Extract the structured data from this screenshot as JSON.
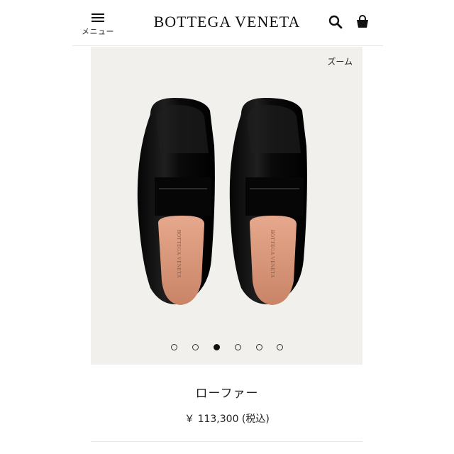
{
  "header": {
    "menu_label": "メニュー",
    "brand": "BOTTEGA VENETA",
    "icons": {
      "menu": "hamburger-icon",
      "search": "search-icon",
      "cart": "shopping-bag-icon"
    }
  },
  "gallery": {
    "zoom_label": "ズーム",
    "insole_brand": "BOTTEGA VENETA",
    "slide_count": 6,
    "active_slide": 3,
    "colors": {
      "background": "#f1f0ec",
      "leather": "#0c0c0c",
      "lining": "#d9957a"
    }
  },
  "product": {
    "name": "ローファー",
    "price": "￥ 113,300 (税込)"
  }
}
